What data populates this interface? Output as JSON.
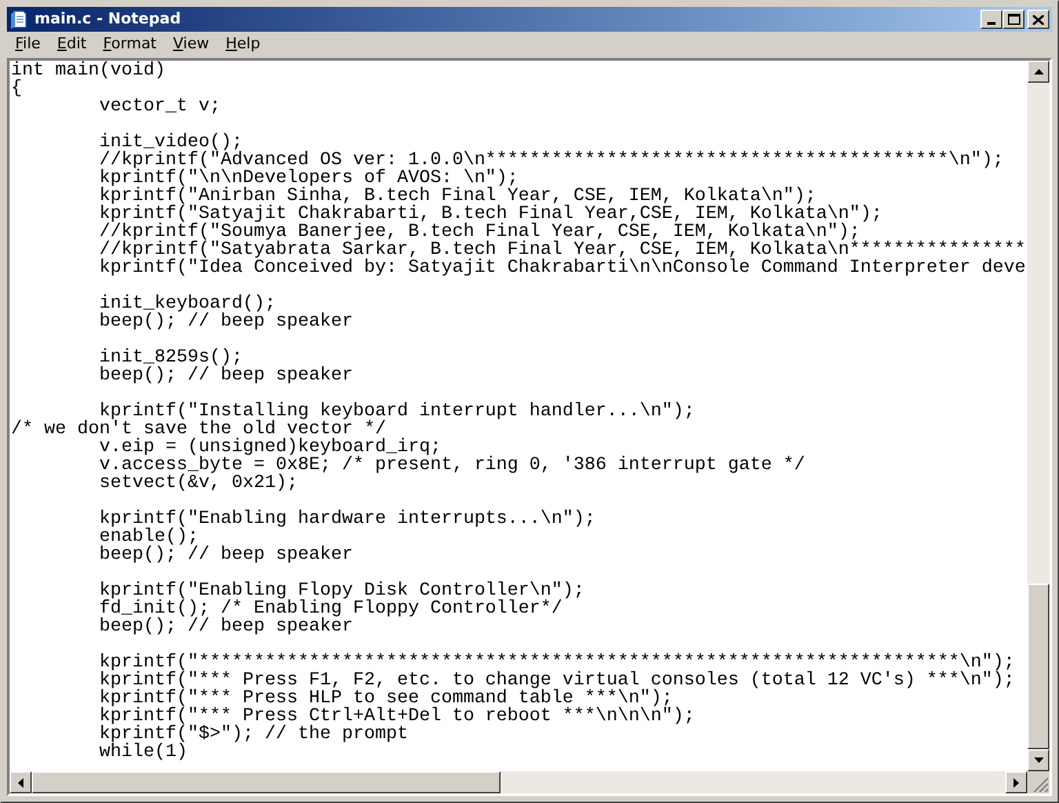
{
  "window": {
    "title": "main.c - Notepad"
  },
  "menu": [
    "File",
    "Edit",
    "Format",
    "View",
    "Help"
  ],
  "editor": {
    "blocks": [
      [
        "int main(void)",
        "{",
        "\tvector_t v;"
      ],
      [
        "\tinit_video();",
        "\t//kprintf(\"Advanced OS ver: 1.0.0\\n******************************************\\n\");",
        "\tkprintf(\"\\n\\nDevelopers of AVOS: \\n\");",
        "\tkprintf(\"Anirban Sinha, B.tech Final Year, CSE, IEM, Kolkata\\n\");",
        "\tkprintf(\"Satyajit Chakrabarti, B.tech Final Year,CSE, IEM, Kolkata\\n\");",
        "\t//kprintf(\"Soumya Banerjee, B.tech Final Year, CSE, IEM, Kolkata\\n\");",
        "\t//kprintf(\"Satyabrata Sarkar, B.tech Final Year, CSE, IEM, Kolkata\\n****************",
        "\tkprintf(\"Idea Conceived by: Satyajit Chakrabarti\\n\\nConsole Command Interpreter deve"
      ],
      [
        "\tinit_keyboard();",
        "\tbeep(); // beep speaker"
      ],
      [
        "\tinit_8259s();",
        "\tbeep(); // beep speaker"
      ],
      [
        "\tkprintf(\"Installing keyboard interrupt handler...\\n\");",
        "/* we don't save the old vector */",
        "\tv.eip = (unsigned)keyboard_irq;",
        "\tv.access_byte = 0x8E; /* present, ring 0, '386 interrupt gate */",
        "\tsetvect(&v, 0x21);"
      ],
      [
        "\tkprintf(\"Enabling hardware interrupts...\\n\");",
        "\tenable();",
        "\tbeep(); // beep speaker"
      ],
      [
        "\tkprintf(\"Enabling Flopy Disk Controller\\n\");",
        "\tfd_init(); /* Enabling Floppy Controller*/",
        "\tbeep(); // beep speaker"
      ],
      [
        "\tkprintf(\"*********************************************************************\\n\");",
        "\tkprintf(\"*** Press F1, F2, etc. to change virtual consoles (total 12 VC's) ***\\n\");",
        "\tkprintf(\"*** Press HLP to see command table ***\\n\");",
        "\tkprintf(\"*** Press Ctrl+Alt+Del to reboot ***\\n\\n\\n\");",
        "\tkprintf(\"$>\"); // the prompt",
        "\twhile(1)"
      ]
    ]
  }
}
